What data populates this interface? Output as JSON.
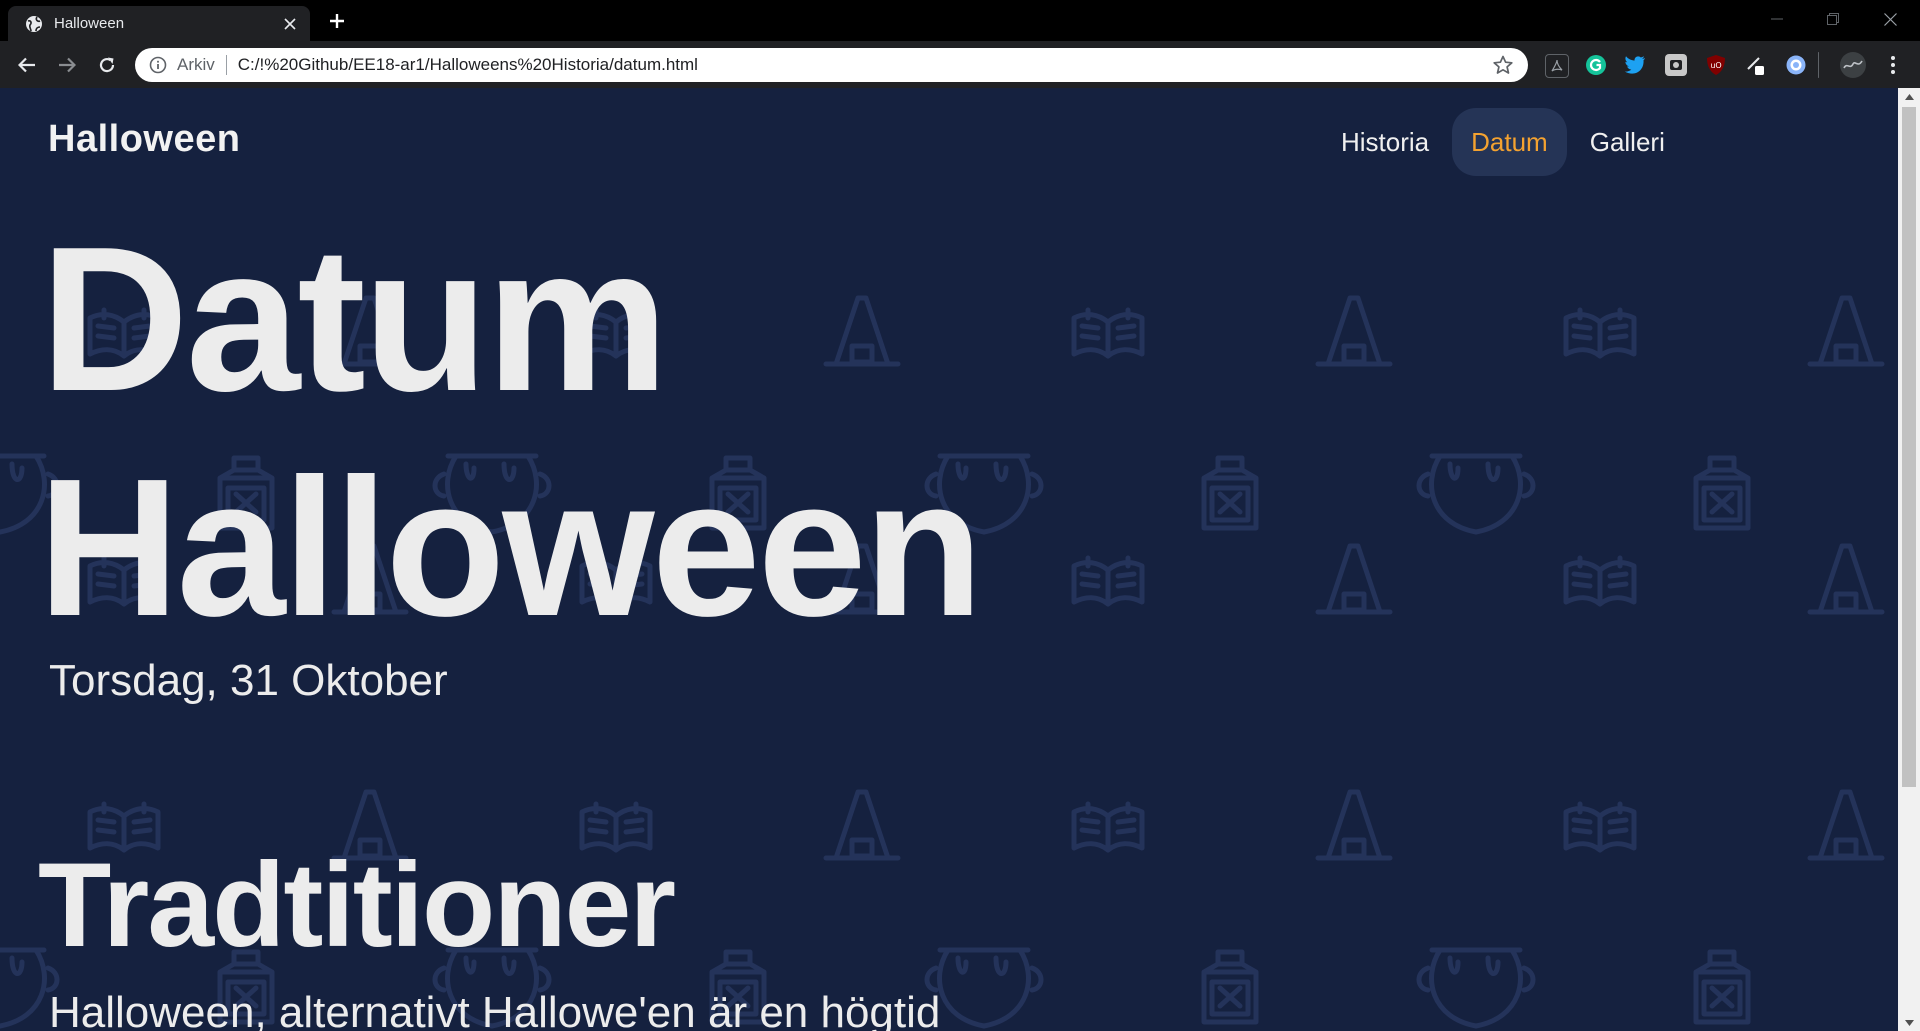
{
  "browser": {
    "tab_title": "Halloween",
    "address_label": "Arkiv",
    "url": "C:/!%20Github/EE18-ar1/Halloweens%20Historia/datum.html",
    "extension_icons": [
      "pdf-icon",
      "grammarly-icon",
      "twitter-icon",
      "screenshot-icon",
      "ublock-icon",
      "pen-icon",
      "circle-extension-icon",
      "profile-avatar-icon"
    ]
  },
  "site": {
    "brand": "Halloween",
    "nav": [
      {
        "label": "Historia",
        "active": false
      },
      {
        "label": "Datum",
        "active": true
      },
      {
        "label": "Galleri",
        "active": false
      }
    ]
  },
  "hero": {
    "line1": "Datum",
    "line2": "Halloween",
    "date": "Torsdag, 31 Oktober"
  },
  "section": {
    "title": "Tradtitioner",
    "text": "Halloween, alternativt Hallowe'en är en högtid"
  },
  "colors": {
    "background": "#15213f",
    "accent": "#f4a230",
    "active_pill": "#253456",
    "pattern_stroke": "#24335a"
  },
  "pattern_icons": [
    "spellbook-icon",
    "witch-hat-icon",
    "cauldron-icon",
    "potion-jar-icon"
  ]
}
